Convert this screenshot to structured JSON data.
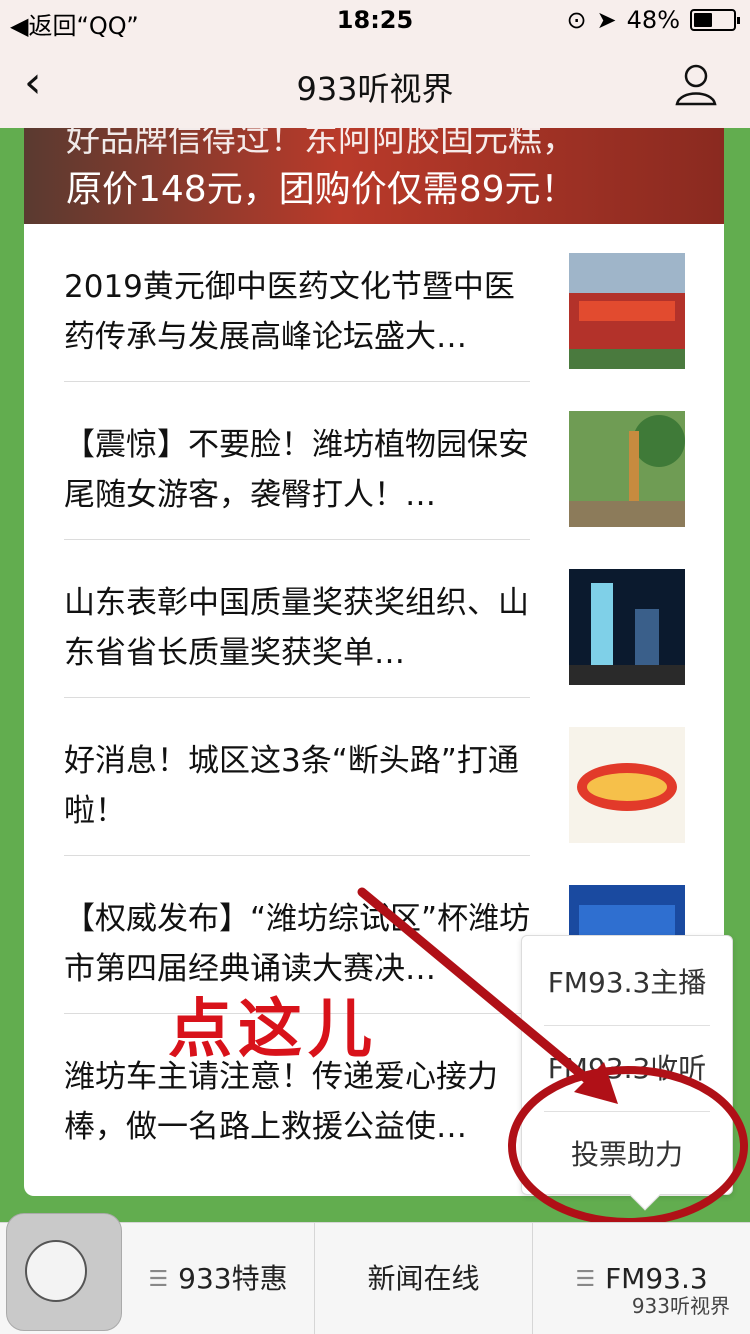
{
  "status_bar": {
    "back_app": "◀返回“QQ”",
    "time": "18:25",
    "battery_text": "48%",
    "battery_level": 0.48
  },
  "nav": {
    "title": "933听视界"
  },
  "banner": {
    "line1": "好品牌信得过！东阿阿胶固元糕，",
    "line2": "原价148元，团购价仅需89元！"
  },
  "articles": [
    {
      "title": "2019黄元御中医药文化节暨中医药传承与发展高峰论坛盛大…"
    },
    {
      "title": "【震惊】不要脸！潍坊植物园保安尾随女游客，袭臀打人！…"
    },
    {
      "title": "山东表彰中国质量奖获奖组织、山东省省长质量奖获奖单…"
    },
    {
      "title": "好消息！城区这3条“断头路”打通啦！"
    },
    {
      "title": "【权威发布】“潍坊综试区”杯潍坊市第四届经典诵读大赛决…"
    },
    {
      "title": "潍坊车主请注意！传递爱心接力棒，做一名路上救援公益使…"
    }
  ],
  "popup_menu": {
    "items": [
      "FM93.3主播",
      "FM93.3收听",
      "投票助力"
    ]
  },
  "annotation": {
    "text": "点这儿"
  },
  "bottom_menu": {
    "tabs": [
      "933特惠",
      "新闻在线",
      "FM93.3"
    ]
  },
  "watermark": "933听视界",
  "colors": {
    "page_green": "#62ad4f",
    "annotation_red": "#d8121a"
  }
}
